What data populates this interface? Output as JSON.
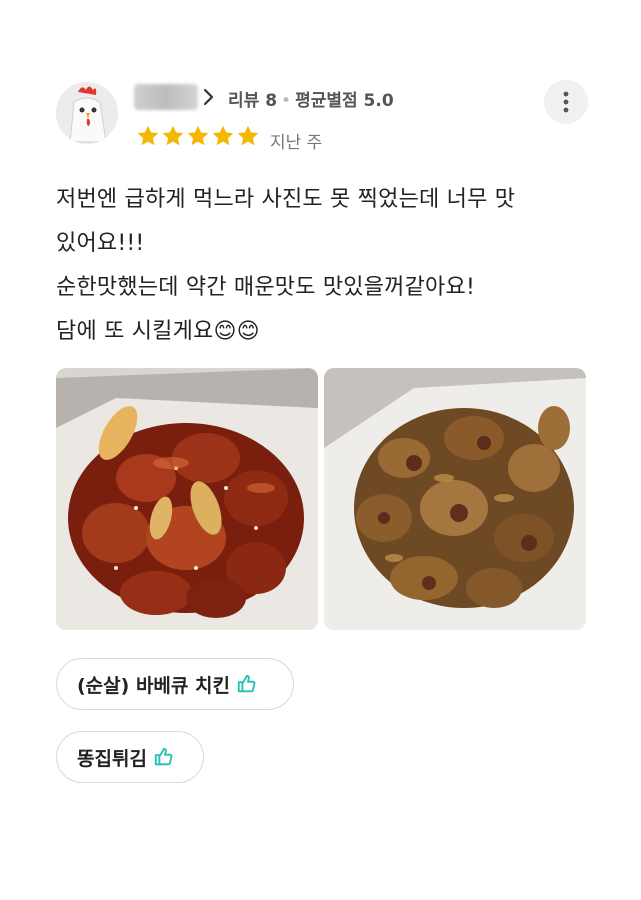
{
  "review": {
    "stats_label": "리뷰 8",
    "avg_label": "평균별점 5.0",
    "rating": 5,
    "date": "지난 주",
    "text_lines": [
      "저번엔 급하게 먹느라 사진도 못 찍었는데 너무 맛",
      "있어요!!!",
      "순한맛했는데 약간 매운맛도 맛있을꺼같아요!",
      "담에 또 시킬게요😊😊"
    ]
  },
  "menu_tags": [
    {
      "label": "(순살) 바베큐 치킨"
    },
    {
      "label": "똥집튀김"
    }
  ],
  "colors": {
    "star": "#f5b800",
    "thumb": "#1fc1b4"
  },
  "icons": {
    "avatar": "chicken-avatar-icon",
    "more": "more-vertical-icon",
    "chevron": "chevron-right-icon",
    "like": "thumbs-up-icon"
  }
}
